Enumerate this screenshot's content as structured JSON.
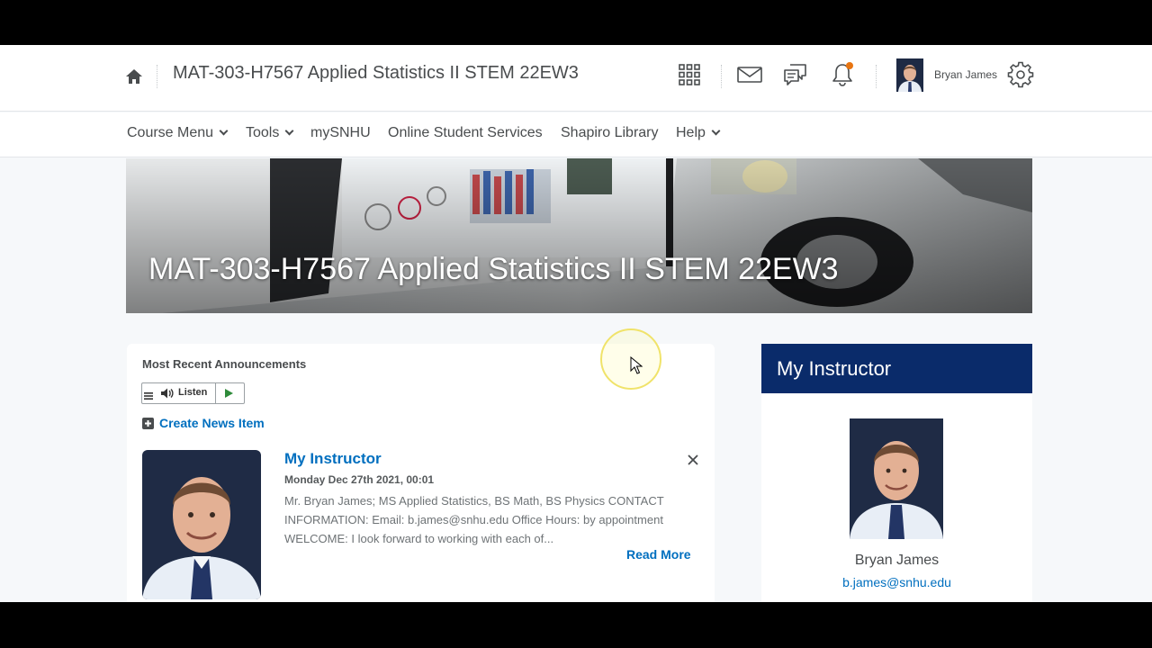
{
  "header": {
    "course_title": "MAT-303-H7567 Applied Statistics II STEM 22EW3",
    "user_name": "Bryan James",
    "notification_dot_color": "#e87511",
    "icons": [
      "home-icon",
      "apps-grid-icon",
      "mail-icon",
      "chat-icon",
      "bell-icon",
      "gear-icon"
    ]
  },
  "nav": {
    "course_menu": "Course Menu",
    "tools": "Tools",
    "mysnhu": "mySNHU",
    "online_services": "Online Student Services",
    "library": "Shapiro Library",
    "help": "Help"
  },
  "banner": {
    "title": "MAT-303-H7567 Applied Statistics II STEM 22EW3"
  },
  "announcements": {
    "heading": "Most Recent Announcements",
    "listen_label": "Listen",
    "create_label": "Create News Item",
    "item": {
      "title": "My Instructor",
      "date": "Monday Dec 27th 2021, 00:01",
      "body": "Mr. Bryan James; MS Applied Statistics, BS Math, BS Physics CONTACT INFORMATION: Email: b.james@snhu.edu Office Hours: by appointment WELCOME: I look forward to working with each of...",
      "read_more": "Read More"
    }
  },
  "instructor": {
    "heading": "My Instructor",
    "name": "Bryan James",
    "email": "b.james@snhu.edu",
    "header_color": "#0a2b6a"
  },
  "colors": {
    "link": "#006fbf",
    "text": "#494c4e",
    "page_bg": "#f6f8fa"
  }
}
